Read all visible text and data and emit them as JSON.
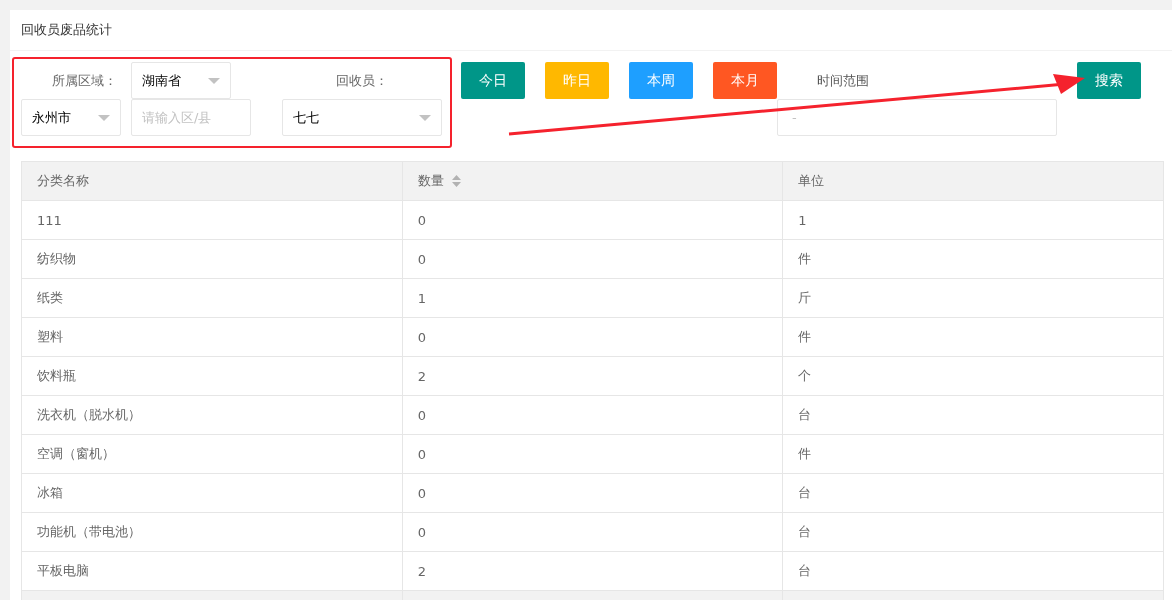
{
  "title": "回收员废品统计",
  "filters": {
    "region_label": "所属区域：",
    "province": {
      "value": "湖南省"
    },
    "city": {
      "value": "永州市"
    },
    "district": {
      "placeholder": "请输入区/县"
    },
    "collector_label": "回收员：",
    "collector": {
      "value": "七七"
    }
  },
  "quick_buttons": [
    {
      "label": "今日",
      "color": "#009688"
    },
    {
      "label": "昨日",
      "color": "#ffb800"
    },
    {
      "label": "本周",
      "color": "#1e9fff"
    },
    {
      "label": "本月",
      "color": "#ff5722"
    }
  ],
  "date_range": {
    "label": "时间范围",
    "separator": "-"
  },
  "search_button": "搜索",
  "table": {
    "columns": [
      {
        "label": "分类名称",
        "kind": "plain"
      },
      {
        "label": "数量",
        "kind": "sortable"
      },
      {
        "label": "单位",
        "kind": "plain"
      }
    ],
    "rows": [
      [
        "111",
        "0",
        "1"
      ],
      [
        "纺织物",
        "0",
        "件"
      ],
      [
        "纸类",
        "1",
        "斤"
      ],
      [
        "塑料",
        "0",
        "件"
      ],
      [
        "饮料瓶",
        "2",
        "个"
      ],
      [
        "洗衣机（脱水机）",
        "0",
        "台"
      ],
      [
        "空调（窗机）",
        "0",
        "件"
      ],
      [
        "冰箱",
        "0",
        "台"
      ],
      [
        "功能机（带电池）",
        "0",
        "台"
      ],
      [
        "平板电脑",
        "2",
        "台"
      ]
    ]
  }
}
